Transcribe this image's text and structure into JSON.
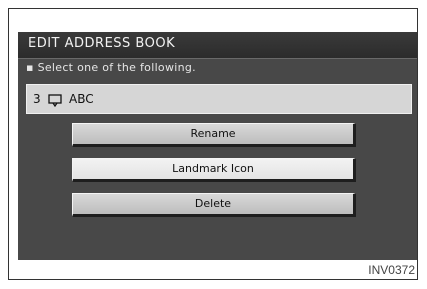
{
  "screen": {
    "title": "EDIT ADDRESS BOOK",
    "instruction": "Select one of the following.",
    "entry": {
      "number": "3",
      "icon": "landmark-icon",
      "name": "ABC"
    },
    "buttons": [
      {
        "label": "Rename"
      },
      {
        "label": "Landmark Icon"
      },
      {
        "label": "Delete"
      }
    ],
    "selected_button": "Landmark Icon"
  },
  "figure_code": "INV0372",
  "colors": {
    "screen_bg": "#484848",
    "title_bg": "#2c2c2c",
    "button_bg": "#c8c8c8",
    "selected_button_bg": "#ececec",
    "entry_bg": "#d6d6d6"
  }
}
